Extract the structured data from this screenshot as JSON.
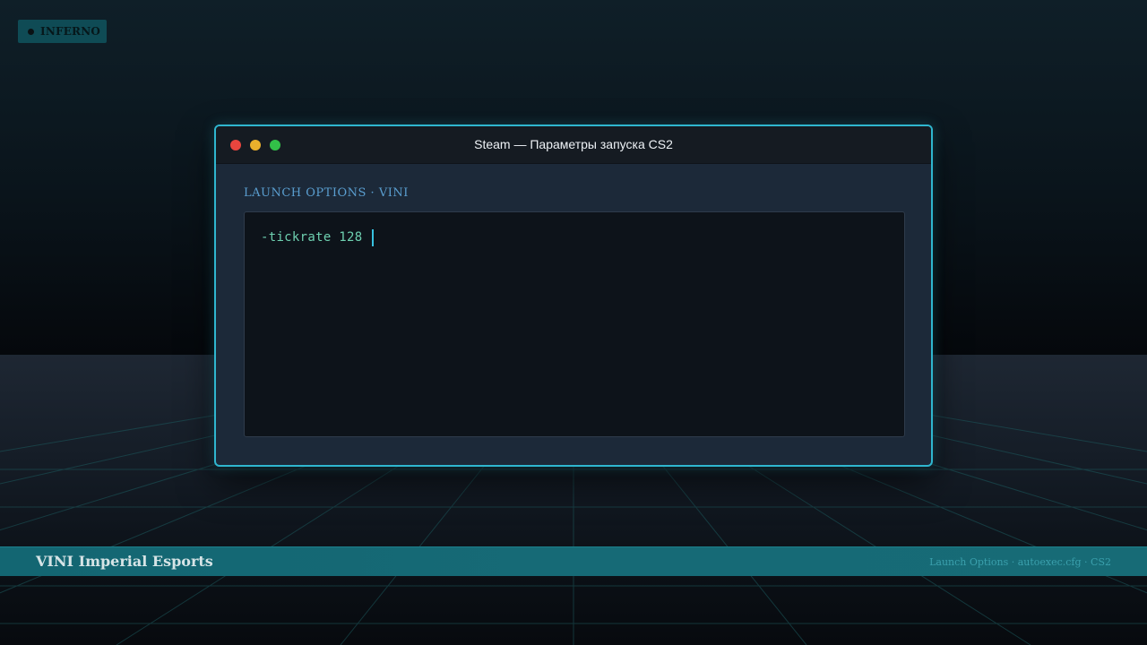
{
  "map_badge": {
    "label": "INFERNO"
  },
  "window": {
    "title": "Steam — Параметры запуска CS2",
    "section_label": "LAUNCH OPTIONS · VINI",
    "launch_options_value": "-tickrate 128"
  },
  "banner": {
    "brand": "VINI Imperial Esports",
    "meta": "Launch Options · autoexec.cfg · CS2"
  },
  "colors": {
    "accent": "#2fb6cf",
    "banner": "#166a76",
    "command_text": "#6ed0b0",
    "traffic_red": "#e9453e",
    "traffic_yellow": "#eab02c",
    "traffic_green": "#32c048"
  }
}
